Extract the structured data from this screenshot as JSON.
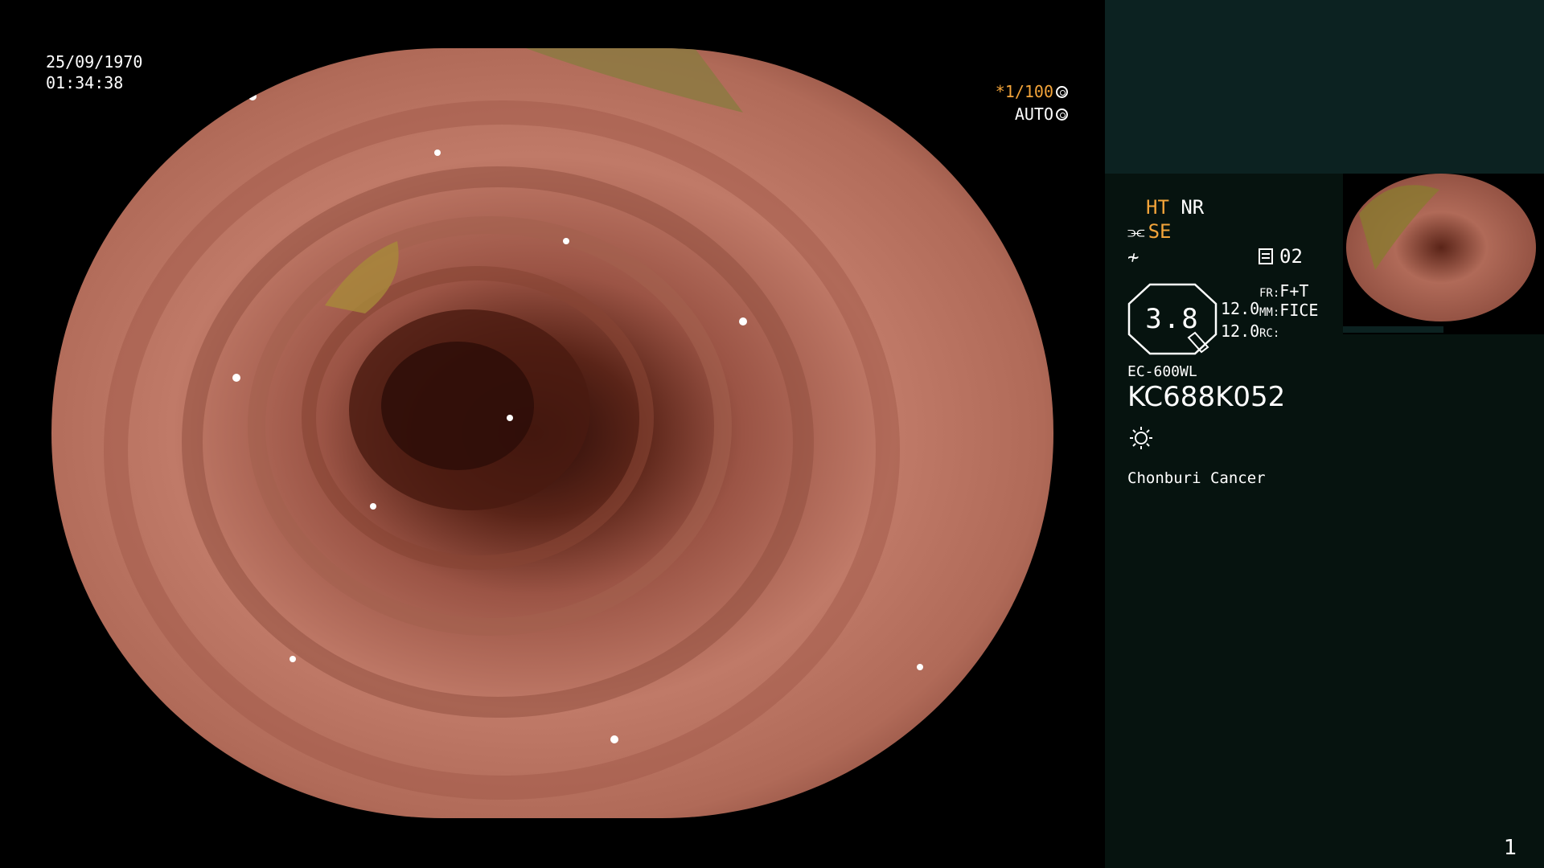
{
  "overlay": {
    "date": "25/09/1970",
    "time": "01:34:38",
    "shutter_speed": "*1/100",
    "iris_mode": "AUTO"
  },
  "panel": {
    "ht": "HT",
    "nr": "NR",
    "se": "SE",
    "capture_count": "02",
    "zoom": "3.8",
    "dist_top": "12.0",
    "dist_bottom": "12.0",
    "fr_label": "FR:",
    "fr_value": "F+T",
    "mm_label": "MM:",
    "mm_value": "FICE",
    "rc_label": "RC:",
    "scope_model": "EC-600WL",
    "scope_serial": "KC688K052",
    "hospital": "Chonburi Cancer",
    "page_number": "1"
  },
  "colors": {
    "accent_orange": "#f3a43a",
    "panel_bg": "#06130f",
    "panel_header_bg": "#0c2221"
  },
  "icons": [
    "cycle-icon",
    "scissors-icon",
    "waveform-icon",
    "capture-icon",
    "light-icon"
  ]
}
